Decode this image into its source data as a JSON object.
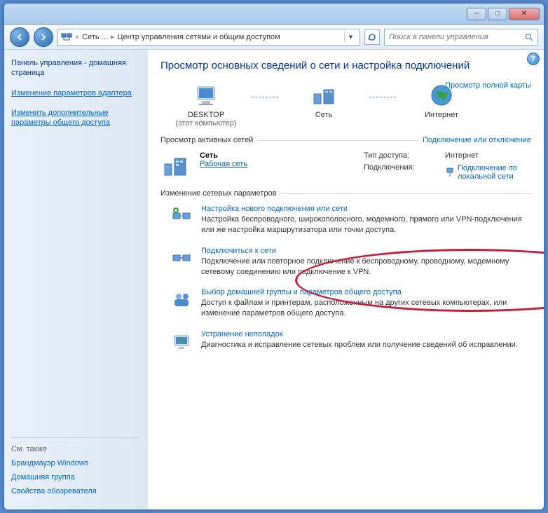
{
  "breadcrumb": {
    "root": "Сеть ...",
    "current": "Центр управления сетями и общим доступом"
  },
  "search": {
    "placeholder": "Поиск в панели управления"
  },
  "sidebar": {
    "home": "Панель управления - домашняя страница",
    "links": [
      "Изменение параметров адаптера",
      "Изменить дополнительные параметры общего доступа"
    ],
    "see_also_title": "См. также",
    "see_also": [
      "Брандмауэр Windows",
      "Домашняя группа",
      "Свойства обозревателя"
    ]
  },
  "content": {
    "title": "Просмотр основных сведений о сети и настройка подключений",
    "view_map": "Просмотр полной карты",
    "diagram": {
      "desktop": "DESKTOP",
      "desktop_sub": "(этот компьютер)",
      "network": "Сеть",
      "internet": "Интернет"
    },
    "active_header": "Просмотр активных сетей",
    "active_action": "Подключение или отключение",
    "active": {
      "name": "Сеть",
      "type": "Рабочая сеть",
      "access_label": "Тип доступа:",
      "access_value": "Интернет",
      "conn_label": "Подключения:",
      "conn_value": "Подключение по локальной сети"
    },
    "settings_header": "Изменение сетевых параметров",
    "tasks": [
      {
        "title": "Настройка нового подключения или сети",
        "desc": "Настройка беспроводного, широкополосного, модемного, прямого или VPN-подключения или же настройка маршрутизатора или точки доступа."
      },
      {
        "title": "Подключиться к сети",
        "desc": "Подключение или повторное подключение к беспроводному, проводному, модемному сетевому соединению или подключение к VPN."
      },
      {
        "title": "Выбор домашней группы и параметров общего доступа",
        "desc": "Доступ к файлам и принтерам, расположенным на других сетевых компьютерах, или изменение параметров общего доступа."
      },
      {
        "title": "Устранение неполадок",
        "desc": "Диагностика и исправление сетевых проблем или получение сведений об исправлении."
      }
    ]
  }
}
